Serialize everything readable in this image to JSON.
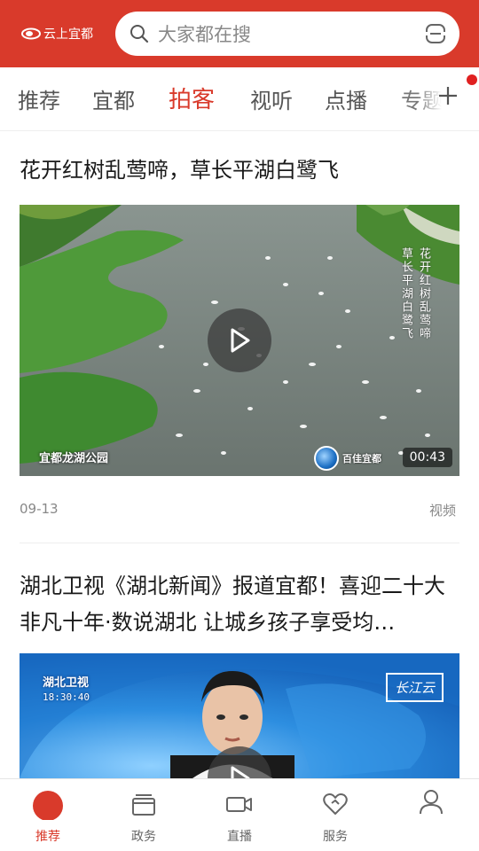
{
  "header": {
    "logo_text": "云上宜都",
    "search_placeholder": "大家都在搜",
    "brand_color": "#d93a2b",
    "icons": [
      "search-icon",
      "scan-icon"
    ]
  },
  "tabs": {
    "items": [
      {
        "label": "推荐",
        "active": false
      },
      {
        "label": "宜都",
        "active": false
      },
      {
        "label": "拍客",
        "active": true
      },
      {
        "label": "视听",
        "active": false
      },
      {
        "label": "点播",
        "active": false
      },
      {
        "label": "专题",
        "active": false
      }
    ],
    "add_icon": "plus-icon"
  },
  "articles": [
    {
      "title": "花开红树乱莺啼，草长平湖白鹭飞",
      "video_caption": "宜都龙湖公园",
      "vertical_text": [
        "花开红树乱莺啼",
        "草长平湖白鹭飞"
      ],
      "station_name": "百佳宜都",
      "duration": "00:43",
      "date": "09-13",
      "type": "视频"
    },
    {
      "title": "湖北卫视《湖北新闻》报道宜都！喜迎二十大 非凡十年·数说湖北 让城乡孩子享受均…",
      "station_tag": "湖北卫视",
      "station_time": "18:30:40",
      "channel_tag": "长江云"
    }
  ],
  "bottom_nav": [
    {
      "label": "推荐",
      "icon": "home-dot-icon",
      "active": true
    },
    {
      "label": "政务",
      "icon": "folder-icon",
      "active": false
    },
    {
      "label": "直播",
      "icon": "video-camera-icon",
      "active": false
    },
    {
      "label": "服务",
      "icon": "heart-icon",
      "active": false
    },
    {
      "label": "",
      "icon": "user-icon",
      "active": false
    }
  ],
  "colors": {
    "accent": "#d93a2b",
    "notification": "#e02020"
  }
}
